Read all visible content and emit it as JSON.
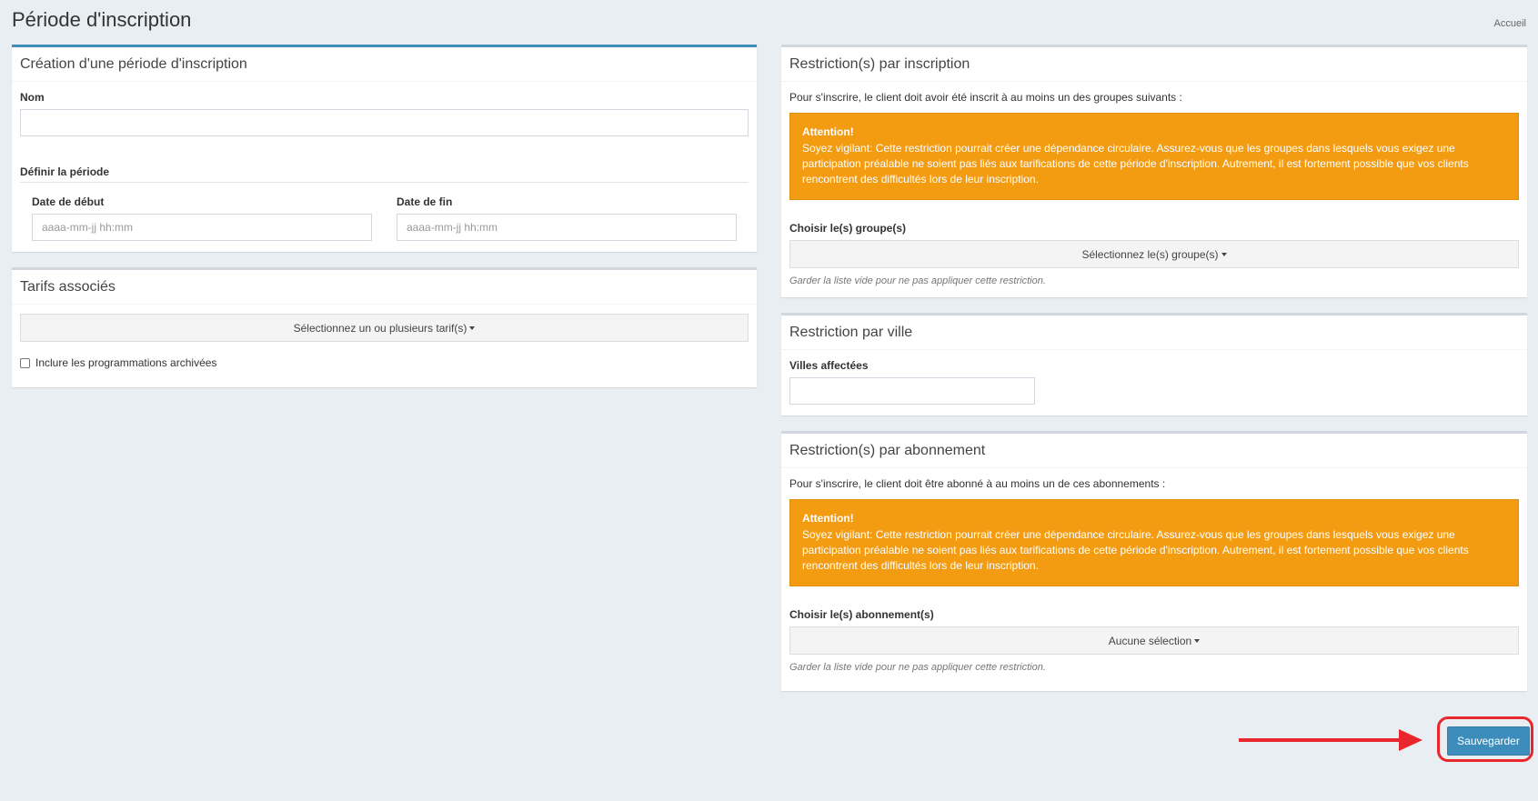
{
  "page": {
    "title": "Période d'inscription",
    "breadcrumb": "Accueil"
  },
  "creation": {
    "title": "Création d'une période d'inscription",
    "name_label": "Nom",
    "name_value": "",
    "period_title": "Définir la période",
    "start_label": "Date de début",
    "start_placeholder": "aaaa-mm-jj hh:mm",
    "end_label": "Date de fin",
    "end_placeholder": "aaaa-mm-jj hh:mm"
  },
  "tarifs": {
    "title": "Tarifs associés",
    "select_label": "Sélectionnez un ou plusieurs tarif(s)",
    "archived_label": "Inclure les programmations archivées"
  },
  "restriction_inscription": {
    "title": "Restriction(s) par inscription",
    "intro": "Pour s'inscrire, le client doit avoir été inscrit à au moins un des groupes suivants :",
    "alert_title": "Attention!",
    "alert_text": "Soyez vigilant: Cette restriction pourrait créer une dépendance circulaire. Assurez-vous que les groupes dans lesquels vous exigez une participation préalable ne soient pas liés aux tarifications de cette période d'inscription. Autrement, il est fortement possible que vos clients rencontrent des difficultés lors de leur inscription.",
    "choose_label": "Choisir le(s) groupe(s)",
    "select_label": "Sélectionnez le(s) groupe(s)",
    "help": "Garder la liste vide pour ne pas appliquer cette restriction."
  },
  "restriction_ville": {
    "title": "Restriction par ville",
    "cities_label": "Villes affectées",
    "cities_value": ""
  },
  "restriction_abonnement": {
    "title": "Restriction(s) par abonnement",
    "intro": "Pour s'inscrire, le client doit être abonné à au moins un de ces abonnements :",
    "alert_title": "Attention!",
    "alert_text": "Soyez vigilant: Cette restriction pourrait créer une dépendance circulaire. Assurez-vous que les groupes dans lesquels vous exigez une participation préalable ne soient pas liés aux tarifications de cette période d'inscription. Autrement, il est fortement possible que vos clients rencontrent des difficultés lors de leur inscription.",
    "choose_label": "Choisir le(s) abonnement(s)",
    "select_label": "Aucune sélection",
    "help": "Garder la liste vide pour ne pas appliquer cette restriction."
  },
  "actions": {
    "save_label": "Sauvegarder"
  },
  "colors": {
    "primary": "#3c8dbc",
    "warning": "#f39c12",
    "annotation": "#e8262b"
  }
}
